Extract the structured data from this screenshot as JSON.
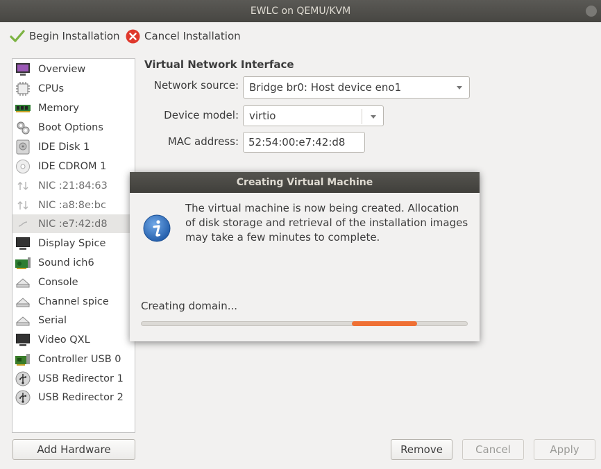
{
  "window": {
    "title": "EWLC on QEMU/KVM"
  },
  "toolbar": {
    "begin_label": "Begin Installation",
    "cancel_label": "Cancel Installation"
  },
  "sidebar": {
    "items": [
      {
        "label": "Overview",
        "icon": "monitor-icon"
      },
      {
        "label": "CPUs",
        "icon": "cpu-icon"
      },
      {
        "label": "Memory",
        "icon": "memory-icon"
      },
      {
        "label": "Boot Options",
        "icon": "gears-icon"
      },
      {
        "label": "IDE Disk 1",
        "icon": "disk-icon"
      },
      {
        "label": "IDE CDROM 1",
        "icon": "cdrom-icon"
      },
      {
        "label": "NIC :21:84:63",
        "icon": "network-icon"
      },
      {
        "label": "NIC :a8:8e:bc",
        "icon": "network-icon"
      },
      {
        "label": "NIC :e7:42:d8",
        "icon": "network-icon",
        "selected": true
      },
      {
        "label": "Display Spice",
        "icon": "display-icon"
      },
      {
        "label": "Sound ich6",
        "icon": "sound-card-icon"
      },
      {
        "label": "Console",
        "icon": "serial-icon"
      },
      {
        "label": "Channel spice",
        "icon": "serial-icon"
      },
      {
        "label": "Serial",
        "icon": "serial-icon"
      },
      {
        "label": "Video QXL",
        "icon": "display-icon"
      },
      {
        "label": "Controller USB 0",
        "icon": "controller-icon"
      },
      {
        "label": "USB Redirector 1",
        "icon": "usb-icon"
      },
      {
        "label": "USB Redirector 2",
        "icon": "usb-icon"
      }
    ],
    "add_hardware_label": "Add Hardware"
  },
  "nic": {
    "section_title": "Virtual Network Interface",
    "network_source_label": "Network source:",
    "network_source_value": "Bridge br0: Host device eno1",
    "device_model_label": "Device model:",
    "device_model_value": "virtio",
    "mac_label": "MAC address:",
    "mac_value": "52:54:00:e7:42:d8"
  },
  "dialog": {
    "title": "Creating Virtual Machine",
    "message": "The virtual machine is now being created. Allocation of disk storage and retrieval of the installation images may take a few minutes to complete.",
    "status": "Creating domain...",
    "progress_indicator": "indeterminate-pulse"
  },
  "buttons": {
    "remove": "Remove",
    "cancel": "Cancel",
    "apply": "Apply"
  },
  "colors": {
    "accent_progress": "#ef7034",
    "titlebar": "#4d4c48",
    "cancel_icon": "#df382c",
    "info_icon": "#2f6db5"
  }
}
